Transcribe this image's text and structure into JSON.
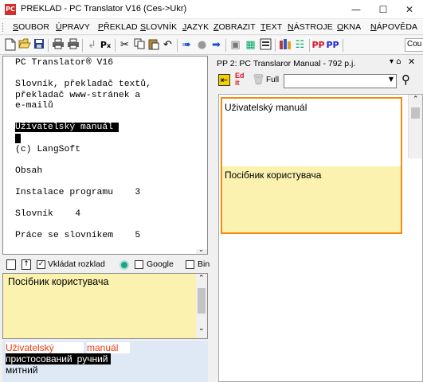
{
  "window": {
    "title": "PREKLAD - PC Translator V16 (Ces->Ukr)",
    "app_icon_text": "PC"
  },
  "menu": {
    "items": [
      "SOUBOR",
      "ÚPRAVY",
      "PŘEKLAD",
      "SLOVNÍK",
      "JAZYK",
      "ZOBRAZIT",
      "TEXT",
      "NÁSTROJE",
      "OKNA",
      "NÁPOVĚDA"
    ]
  },
  "toolbar": {
    "font_name": "Cou",
    "icons": [
      "new-file-icon",
      "open-folder-icon",
      "save-icon",
      "print-icon",
      "print-preview-icon",
      "format-icon",
      "clear-format-icon",
      "cut-icon",
      "copy-icon",
      "paste-icon",
      "undo-icon",
      "translate-next-icon",
      "stop-icon",
      "translate-icon",
      "dictionary-icon",
      "auto-translate-icon",
      "books-icon",
      "phrase-icon",
      "pp-icon",
      "pp-edit-icon"
    ]
  },
  "source": {
    "lines": [
      "PC Translator® V16",
      "",
      "Slovník, překladač textů,",
      "překladač www-stránek a",
      "e-mailů",
      "",
      "Uživatelský manuál",
      "",
      "(c) LangSoft",
      "",
      "Obsah",
      "",
      "Instalace programu    3",
      "",
      "Slovník    4",
      "",
      "Práce se slovníkem    5"
    ],
    "highlighted": "Uživatelský manuál "
  },
  "mid_toolbar": {
    "vkladat_label": "Vkládat rozklad",
    "google_label": "Google",
    "bing_label": "Bin"
  },
  "translation": {
    "text": "Посібник користувача"
  },
  "dictionary": {
    "row1_a": "Uživatelský",
    "row1_b": "manuál",
    "row2_a": "пристосований",
    "row2_b": "ручний",
    "row3": "митний"
  },
  "pp_panel": {
    "title": "PP 2: PC Translaror Manual - 792 p.j.",
    "full_label": "Full",
    "segment_source": "Uživatelský manuál",
    "segment_target": "Посібник користувача"
  },
  "colors": {
    "accent_orange": "#f48a12",
    "translation_bg": "#fbf2b0",
    "dictionary_bg": "#dfe9f5",
    "dict_red": "#e83a10"
  }
}
